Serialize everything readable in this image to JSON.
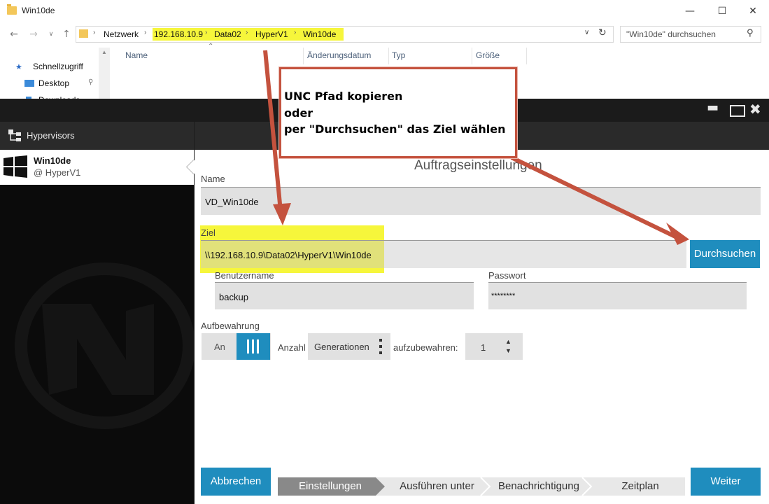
{
  "explorer": {
    "title": "Win10de",
    "address": {
      "root": "Netzwerk",
      "segments": [
        "192.168.10.9",
        "Data02",
        "HyperV1",
        "Win10de"
      ]
    },
    "search_placeholder": "\"Win10de\" durchsuchen",
    "sidebar": [
      {
        "label": "Schnellzugriff",
        "icon": "star-icon"
      },
      {
        "label": "Desktop",
        "icon": "desktop-icon"
      },
      {
        "label": "Downloads",
        "icon": "download-icon"
      }
    ],
    "columns": [
      "Name",
      "Änderungsdatum",
      "Typ",
      "Größe"
    ]
  },
  "app": {
    "hypervisors_label": "Hypervisors",
    "selected_vm": {
      "name": "Win10de",
      "host": "@ HyperV1"
    },
    "section_title": "Auftragseinstellungen",
    "name_label": "Name",
    "name_value": "VD_Win10de",
    "ziel_label": "Ziel",
    "ziel_value": "\\\\192.168.10.9\\Data02\\HyperV1\\Win10de",
    "browse_label": "Durchsuchen",
    "user_label": "Benutzername",
    "user_value": "backup",
    "password_label": "Passwort",
    "password_value": "********",
    "retention_label": "Aufbewahrung",
    "retention_toggle": "An",
    "retention_count_label": "Anzahl",
    "retention_mode": "Generationen",
    "retention_keep_label": "aufzubewahren:",
    "retention_keep_value": "1",
    "cancel_label": "Abbrechen",
    "next_label": "Weiter",
    "steps": [
      "Einstellungen",
      "Ausführen unter",
      "Benachrichtigung",
      "Zeitplan"
    ]
  },
  "annotation": {
    "lines": [
      "UNC Pfad kopieren",
      "oder",
      "per \"Durchsuchen\" das Ziel wählen"
    ]
  },
  "colors": {
    "highlight": "#f6f63b",
    "arrow": "#c4523e",
    "accent_blue": "#1f8dbe"
  }
}
